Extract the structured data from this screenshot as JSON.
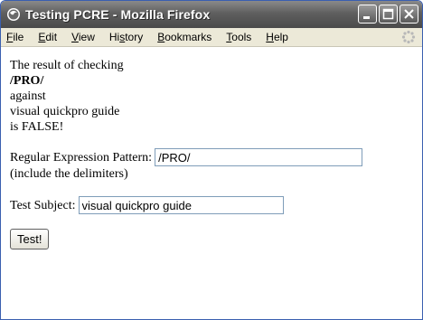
{
  "window": {
    "title": "Testing PCRE - Mozilla Firefox"
  },
  "menu": {
    "items": [
      "File",
      "Edit",
      "View",
      "History",
      "Bookmarks",
      "Tools",
      "Help"
    ],
    "mnemonics": [
      "F",
      "E",
      "V",
      "s",
      "B",
      "T",
      "H"
    ]
  },
  "result": {
    "line1": "The result of checking",
    "pattern": "/PRO/",
    "line3": "against",
    "subject": "visual quickpro guide",
    "verdict": "is FALSE!"
  },
  "form": {
    "pattern_label": "Regular Expression Pattern:",
    "pattern_value": "/PRO/",
    "pattern_hint": "(include the delimiters)",
    "subject_label": "Test Subject:",
    "subject_value": "visual quickpro guide",
    "submit_label": "Test!"
  },
  "icons": [
    "firefox-app-icon",
    "minimize-icon",
    "maximize-icon",
    "close-icon",
    "throbber-icon"
  ],
  "colors": {
    "titlebar": "#5f5f5f",
    "menubar": "#ece9d8",
    "input_border": "#7f9db9"
  }
}
